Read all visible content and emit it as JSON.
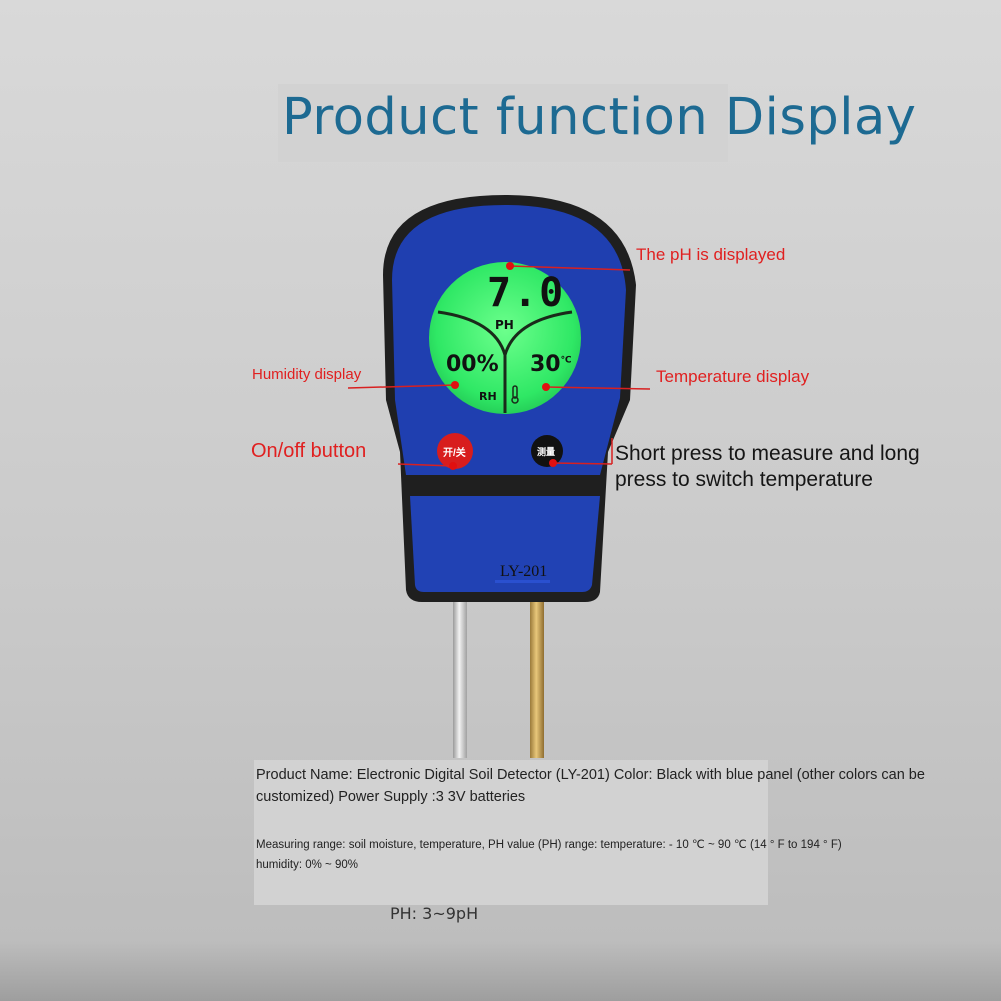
{
  "title": "Product function Display",
  "device": {
    "lcd": {
      "ph_value": "7.0",
      "ph_unit": "PH",
      "humidity_value": "00%",
      "temperature_value": "30",
      "temperature_unit": "℃",
      "rh_label": "RH"
    },
    "power_button_label": "开/关",
    "measure_button_label": "测量",
    "model": "LY-201",
    "colors": {
      "body_black": "#1f1f1f",
      "panel_blue": "#1f3fb0",
      "lcd_green": "#33ee66",
      "power_button_red": "#d81d1d"
    }
  },
  "callouts": {
    "ph": "The pH is displayed",
    "humidity": "Humidity display",
    "temperature": "Temperature display",
    "power": "On/off button",
    "measure_line1": "Short press to measure and long",
    "measure_line2": "press to switch temperature",
    "callout_color": "#e02020"
  },
  "info": {
    "main": "Product Name: Electronic Digital Soil Detector (LY-201) Color: Black with blue panel (other colors can be customized) Power Supply :3 3V batteries",
    "spec_line1": "Measuring range: soil moisture, temperature, PH value (PH) range: temperature: - 10 ℃ ~ 90 ℃ (14 ° F to 194 ° F)",
    "spec_line2": "humidity: 0% ~ 90%",
    "ph_range": "PH: 3~9pH"
  }
}
